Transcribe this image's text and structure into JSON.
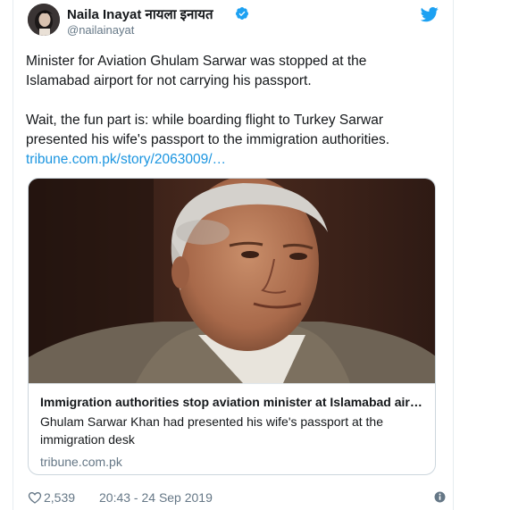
{
  "author": {
    "display_name": "Naila Inayat नायला इनायत",
    "handle": "@nailainayat",
    "verified": true
  },
  "tweet": {
    "paragraph1": "Minister for Aviation Ghulam Sarwar was stopped at the Islamabad airport for not carrying his passport.",
    "paragraph2": "Wait, the fun part is: while boarding flight to Turkey Sarwar presented his wife's passport to the immigration authorities.",
    "link": "tribune.com.pk/story/2063009/…"
  },
  "card": {
    "title": "Immigration authorities stop aviation minister at Islamabad air…",
    "description": "Ghulam Sarwar Khan had presented his wife's passport at the immigration desk",
    "domain": "tribune.com.pk"
  },
  "footer": {
    "likes": "2,539",
    "timestamp": "20:43 - 24 Sep 2019"
  },
  "icons": {
    "verified": "verified-badge-icon",
    "brand": "twitter-bird-icon",
    "like": "heart-icon",
    "info": "info-icon"
  },
  "colors": {
    "link": "#1b95e0",
    "verified": "#1da1f2",
    "muted": "#657786"
  }
}
